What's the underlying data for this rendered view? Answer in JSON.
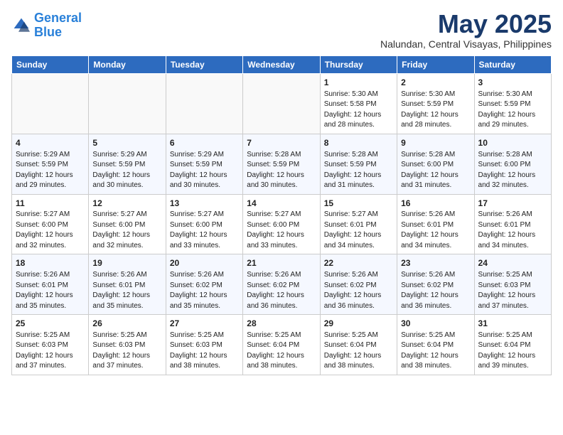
{
  "header": {
    "logo_line1": "General",
    "logo_line2": "Blue",
    "month_year": "May 2025",
    "location": "Nalundan, Central Visayas, Philippines"
  },
  "weekdays": [
    "Sunday",
    "Monday",
    "Tuesday",
    "Wednesday",
    "Thursday",
    "Friday",
    "Saturday"
  ],
  "weeks": [
    [
      {
        "day": "",
        "lines": []
      },
      {
        "day": "",
        "lines": []
      },
      {
        "day": "",
        "lines": []
      },
      {
        "day": "",
        "lines": []
      },
      {
        "day": "1",
        "lines": [
          "Sunrise: 5:30 AM",
          "Sunset: 5:58 PM",
          "Daylight: 12 hours",
          "and 28 minutes."
        ]
      },
      {
        "day": "2",
        "lines": [
          "Sunrise: 5:30 AM",
          "Sunset: 5:59 PM",
          "Daylight: 12 hours",
          "and 28 minutes."
        ]
      },
      {
        "day": "3",
        "lines": [
          "Sunrise: 5:30 AM",
          "Sunset: 5:59 PM",
          "Daylight: 12 hours",
          "and 29 minutes."
        ]
      }
    ],
    [
      {
        "day": "4",
        "lines": [
          "Sunrise: 5:29 AM",
          "Sunset: 5:59 PM",
          "Daylight: 12 hours",
          "and 29 minutes."
        ]
      },
      {
        "day": "5",
        "lines": [
          "Sunrise: 5:29 AM",
          "Sunset: 5:59 PM",
          "Daylight: 12 hours",
          "and 30 minutes."
        ]
      },
      {
        "day": "6",
        "lines": [
          "Sunrise: 5:29 AM",
          "Sunset: 5:59 PM",
          "Daylight: 12 hours",
          "and 30 minutes."
        ]
      },
      {
        "day": "7",
        "lines": [
          "Sunrise: 5:28 AM",
          "Sunset: 5:59 PM",
          "Daylight: 12 hours",
          "and 30 minutes."
        ]
      },
      {
        "day": "8",
        "lines": [
          "Sunrise: 5:28 AM",
          "Sunset: 5:59 PM",
          "Daylight: 12 hours",
          "and 31 minutes."
        ]
      },
      {
        "day": "9",
        "lines": [
          "Sunrise: 5:28 AM",
          "Sunset: 6:00 PM",
          "Daylight: 12 hours",
          "and 31 minutes."
        ]
      },
      {
        "day": "10",
        "lines": [
          "Sunrise: 5:28 AM",
          "Sunset: 6:00 PM",
          "Daylight: 12 hours",
          "and 32 minutes."
        ]
      }
    ],
    [
      {
        "day": "11",
        "lines": [
          "Sunrise: 5:27 AM",
          "Sunset: 6:00 PM",
          "Daylight: 12 hours",
          "and 32 minutes."
        ]
      },
      {
        "day": "12",
        "lines": [
          "Sunrise: 5:27 AM",
          "Sunset: 6:00 PM",
          "Daylight: 12 hours",
          "and 32 minutes."
        ]
      },
      {
        "day": "13",
        "lines": [
          "Sunrise: 5:27 AM",
          "Sunset: 6:00 PM",
          "Daylight: 12 hours",
          "and 33 minutes."
        ]
      },
      {
        "day": "14",
        "lines": [
          "Sunrise: 5:27 AM",
          "Sunset: 6:00 PM",
          "Daylight: 12 hours",
          "and 33 minutes."
        ]
      },
      {
        "day": "15",
        "lines": [
          "Sunrise: 5:27 AM",
          "Sunset: 6:01 PM",
          "Daylight: 12 hours",
          "and 34 minutes."
        ]
      },
      {
        "day": "16",
        "lines": [
          "Sunrise: 5:26 AM",
          "Sunset: 6:01 PM",
          "Daylight: 12 hours",
          "and 34 minutes."
        ]
      },
      {
        "day": "17",
        "lines": [
          "Sunrise: 5:26 AM",
          "Sunset: 6:01 PM",
          "Daylight: 12 hours",
          "and 34 minutes."
        ]
      }
    ],
    [
      {
        "day": "18",
        "lines": [
          "Sunrise: 5:26 AM",
          "Sunset: 6:01 PM",
          "Daylight: 12 hours",
          "and 35 minutes."
        ]
      },
      {
        "day": "19",
        "lines": [
          "Sunrise: 5:26 AM",
          "Sunset: 6:01 PM",
          "Daylight: 12 hours",
          "and 35 minutes."
        ]
      },
      {
        "day": "20",
        "lines": [
          "Sunrise: 5:26 AM",
          "Sunset: 6:02 PM",
          "Daylight: 12 hours",
          "and 35 minutes."
        ]
      },
      {
        "day": "21",
        "lines": [
          "Sunrise: 5:26 AM",
          "Sunset: 6:02 PM",
          "Daylight: 12 hours",
          "and 36 minutes."
        ]
      },
      {
        "day": "22",
        "lines": [
          "Sunrise: 5:26 AM",
          "Sunset: 6:02 PM",
          "Daylight: 12 hours",
          "and 36 minutes."
        ]
      },
      {
        "day": "23",
        "lines": [
          "Sunrise: 5:26 AM",
          "Sunset: 6:02 PM",
          "Daylight: 12 hours",
          "and 36 minutes."
        ]
      },
      {
        "day": "24",
        "lines": [
          "Sunrise: 5:25 AM",
          "Sunset: 6:03 PM",
          "Daylight: 12 hours",
          "and 37 minutes."
        ]
      }
    ],
    [
      {
        "day": "25",
        "lines": [
          "Sunrise: 5:25 AM",
          "Sunset: 6:03 PM",
          "Daylight: 12 hours",
          "and 37 minutes."
        ]
      },
      {
        "day": "26",
        "lines": [
          "Sunrise: 5:25 AM",
          "Sunset: 6:03 PM",
          "Daylight: 12 hours",
          "and 37 minutes."
        ]
      },
      {
        "day": "27",
        "lines": [
          "Sunrise: 5:25 AM",
          "Sunset: 6:03 PM",
          "Daylight: 12 hours",
          "and 38 minutes."
        ]
      },
      {
        "day": "28",
        "lines": [
          "Sunrise: 5:25 AM",
          "Sunset: 6:04 PM",
          "Daylight: 12 hours",
          "and 38 minutes."
        ]
      },
      {
        "day": "29",
        "lines": [
          "Sunrise: 5:25 AM",
          "Sunset: 6:04 PM",
          "Daylight: 12 hours",
          "and 38 minutes."
        ]
      },
      {
        "day": "30",
        "lines": [
          "Sunrise: 5:25 AM",
          "Sunset: 6:04 PM",
          "Daylight: 12 hours",
          "and 38 minutes."
        ]
      },
      {
        "day": "31",
        "lines": [
          "Sunrise: 5:25 AM",
          "Sunset: 6:04 PM",
          "Daylight: 12 hours",
          "and 39 minutes."
        ]
      }
    ]
  ]
}
